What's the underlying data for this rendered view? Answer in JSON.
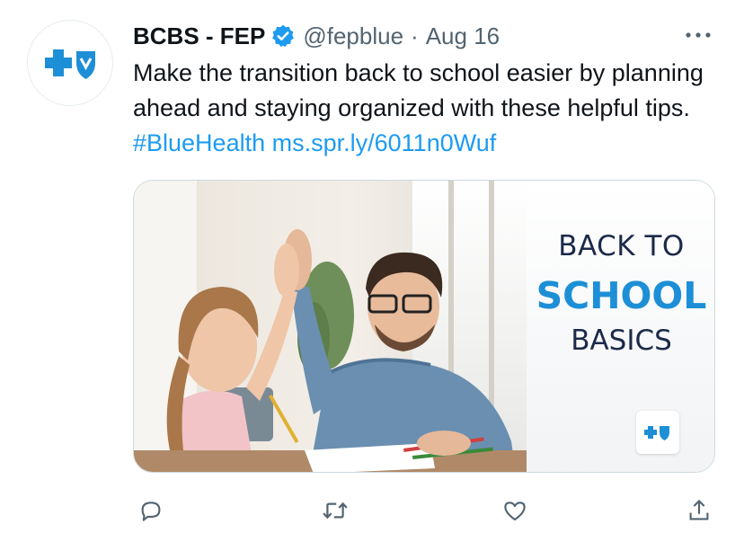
{
  "tweet": {
    "author_name": "BCBS - FEP",
    "handle": "@fepblue",
    "separator": "·",
    "date": "Aug 16",
    "text_plain": "Make the transition back to school easier by planning ahead and staying organized with these helpful tips. ",
    "hashtag": "#BlueHealth",
    "link": "ms.spr.ly/6011n0Wuf"
  },
  "media": {
    "promo_line1": "BACK TO",
    "promo_line2": "SCHOOL",
    "promo_line3": "BASICS"
  },
  "icons": {
    "avatar": "bcbs-logo-icon",
    "verified": "verified-badge-icon",
    "more": "more-options-icon",
    "reply": "reply-icon",
    "retweet": "retweet-icon",
    "like": "heart-icon",
    "share": "share-icon"
  },
  "colors": {
    "accent": "#1d9bf0",
    "brand_blue": "#1d8fd6",
    "text_primary": "#0f1419",
    "text_secondary": "#536471"
  }
}
